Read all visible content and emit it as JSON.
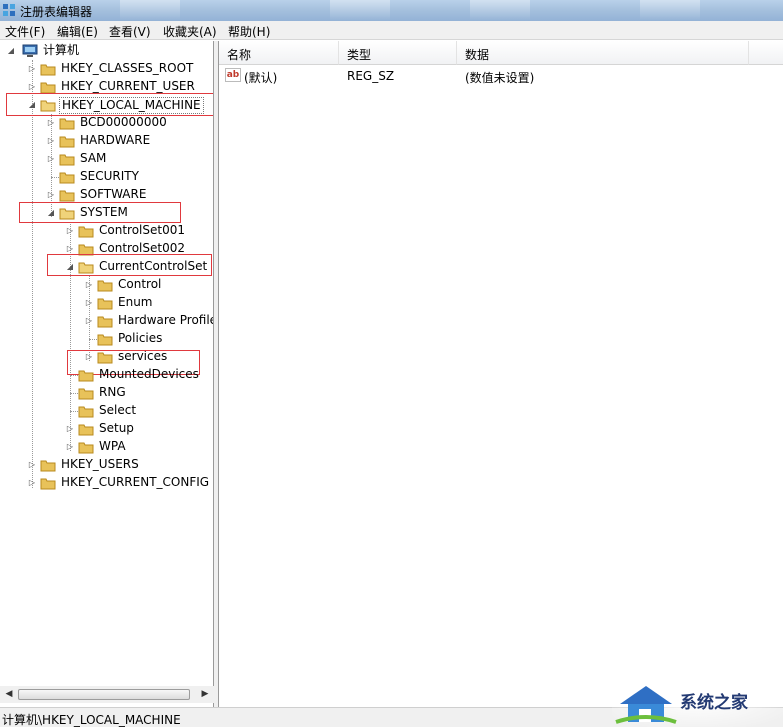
{
  "window": {
    "title": "注册表编辑器"
  },
  "menu": [
    "文件(F)",
    "编辑(E)",
    "查看(V)",
    "收藏夹(A)",
    "帮助(H)"
  ],
  "tree": {
    "root": "计算机",
    "hkcr": "HKEY_CLASSES_ROOT",
    "hkcu": "HKEY_CURRENT_USER",
    "hklm": "HKEY_LOCAL_MACHINE",
    "bcd": "BCD00000000",
    "hardware": "HARDWARE",
    "sam": "SAM",
    "security": "SECURITY",
    "software": "SOFTWARE",
    "system": "SYSTEM",
    "controlset001": "ControlSet001",
    "controlset002": "ControlSet002",
    "currentcontrolset": "CurrentControlSet",
    "control": "Control",
    "enum": "Enum",
    "hardware_profiles": "Hardware Profiles",
    "policies": "Policies",
    "services": "services",
    "mounteddevices": "MountedDevices",
    "rng": "RNG",
    "select": "Select",
    "setup": "Setup",
    "wpa": "WPA",
    "hku": "HKEY_USERS",
    "hkcc": "HKEY_CURRENT_CONFIG"
  },
  "columns": {
    "name": "名称",
    "type": "类型",
    "data": "数据"
  },
  "values": [
    {
      "icon": "string-value-icon",
      "icon_text": "ab",
      "name": "(默认)",
      "type": "REG_SZ",
      "data": "(数值未设置)"
    }
  ],
  "status": {
    "path": "计算机\\HKEY_LOCAL_MACHINE"
  },
  "watermark": {
    "text": "系统之家"
  },
  "colors": {
    "highlight": "#e0393e",
    "folder": "#e8c25a",
    "titlebar": "#a6c1de"
  }
}
